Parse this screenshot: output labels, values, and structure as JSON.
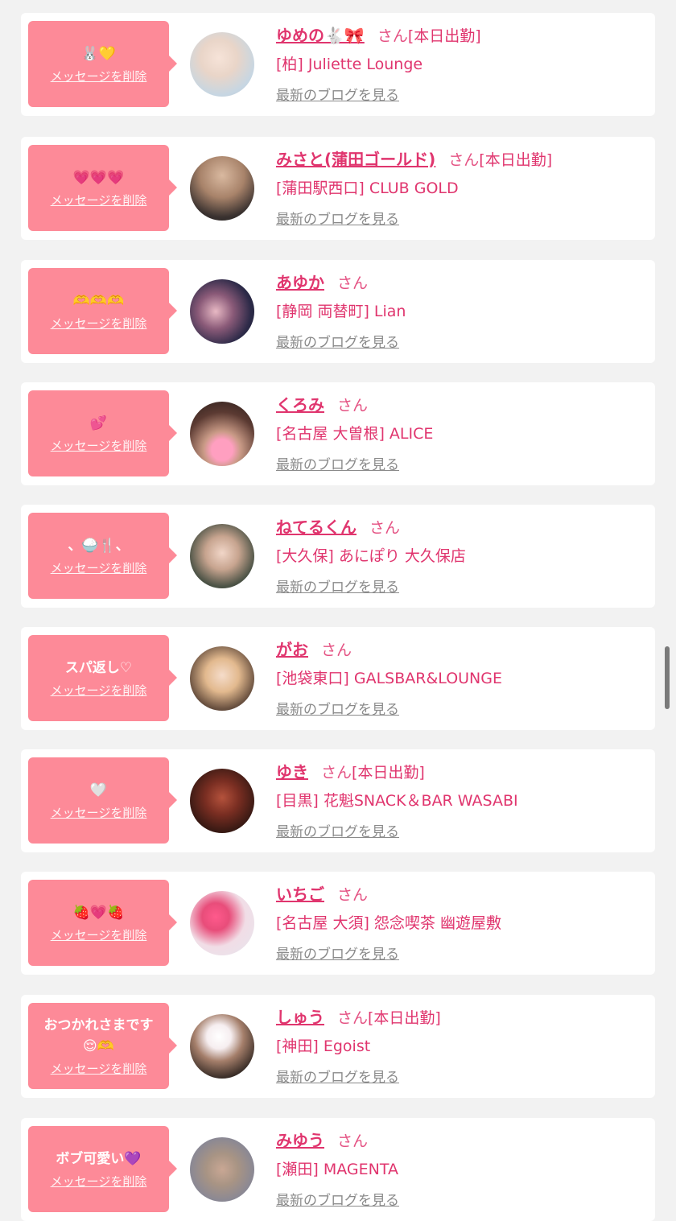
{
  "common": {
    "san": "さん",
    "delete_label": "メッセージを削除",
    "blog_label": "最新のブログを見る"
  },
  "colors": {
    "accent": "#e0356e",
    "bubble": "#fd8a98",
    "background": "#f2f2f2"
  },
  "favorites": [
    {
      "message": "🐰💛",
      "name": "ゆめの🐇🎀",
      "status": "[本日出勤]",
      "shop": "[柏] Juliette Lounge"
    },
    {
      "message": "💗💗💗",
      "name": "みさと(蒲田ゴールド)",
      "status": "[本日出勤]",
      "shop": "[蒲田駅西口] CLUB GOLD"
    },
    {
      "message": "🫶🫶🫶",
      "name": "あゆか",
      "status": "",
      "shop": "[静岡 両替町] Lian"
    },
    {
      "message": "💕",
      "name": "くろみ",
      "status": "",
      "shop": "[名古屋 大曽根] ALICE"
    },
    {
      "message": "、🍚🍴、",
      "name": "ねてるくん",
      "status": "",
      "shop": "[大久保] あにぽり 大久保店"
    },
    {
      "message": "スパ返し♡",
      "name": "がお",
      "status": "",
      "shop": "[池袋東口] GALSBAR&LOUNGE"
    },
    {
      "message": "🤍",
      "name": "ゆき",
      "status": "[本日出勤]",
      "shop": "[目黒] 花魁SNACK＆BAR WASABI"
    },
    {
      "message": "🍓💗🍓",
      "name": "いちご",
      "status": "",
      "shop": "[名古屋 大須] 怨念喫茶 幽遊屋敷"
    },
    {
      "message": "おつかれさまです\n😌🫶",
      "name": "しゅう",
      "status": "[本日出勤]",
      "shop": "[神田] Egoist"
    },
    {
      "message": "ボブ可愛い💜",
      "name": "みゆう",
      "status": "",
      "shop": "[瀬田] MAGENTA"
    }
  ]
}
